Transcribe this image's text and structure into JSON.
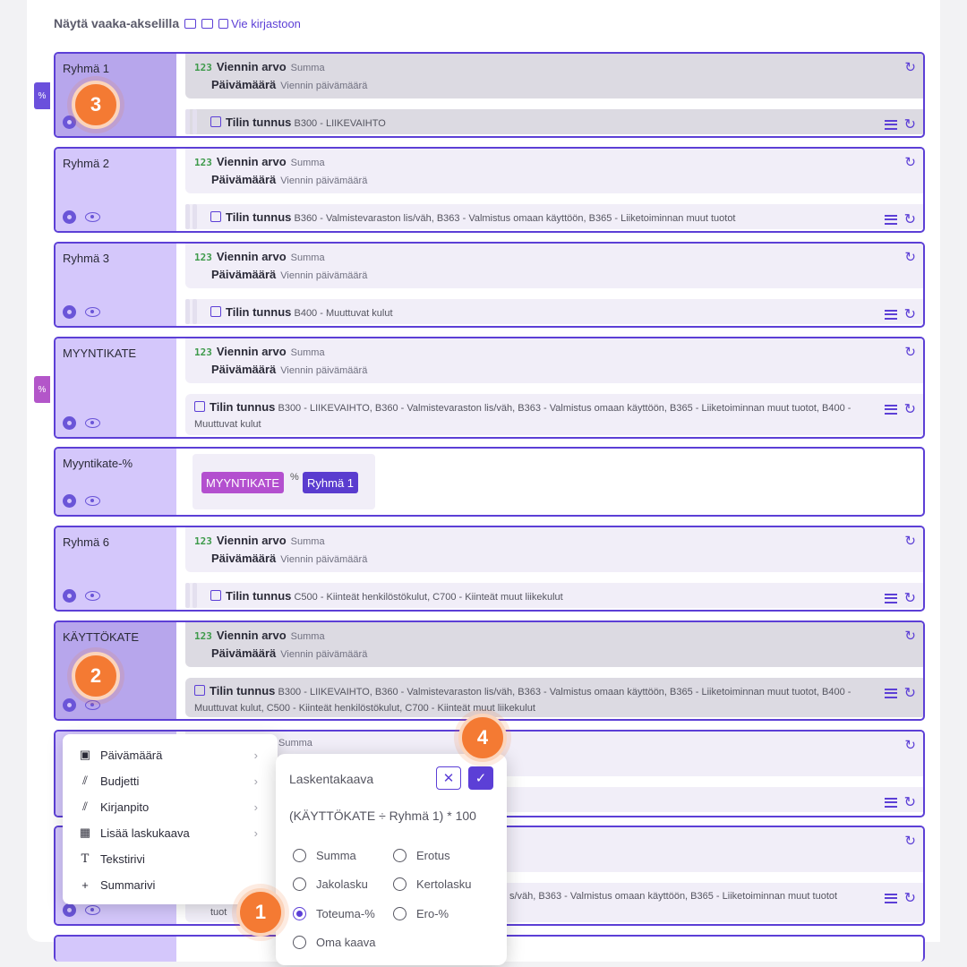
{
  "toolbar": {
    "title": "Näytä vaaka-akselilla",
    "export_label": "Vie kirjastoon"
  },
  "common": {
    "value_field": "Viennin arvo",
    "value_agg": "Summa",
    "date_field": "Päivämäärä",
    "date_sub": "Viennin päivämäärä",
    "account_field": "Tilin tunnus",
    "num_icon": "123",
    "pct": "%",
    "refresh_icon": "↻"
  },
  "groups": [
    {
      "name": "Ryhmä 1",
      "accounts": "B300 - LIIKEVAIHTO"
    },
    {
      "name": "Ryhmä 2",
      "accounts": "B360 - Valmistevaraston lis/väh, B363 - Valmistus omaan käyttöön, B365 - Liiketoiminnan muut tuotot"
    },
    {
      "name": "Ryhmä 3",
      "accounts": "B400 - Muuttuvat kulut"
    },
    {
      "name": "MYYNTIKATE",
      "accounts": "B300 - LIIKEVAIHTO, B360 - Valmistevaraston lis/väh, B363 - Valmistus omaan käyttöön, B365 - Liiketoiminnan muut tuotot, B400 - Muuttuvat kulut"
    },
    {
      "name": "Myyntikate-%",
      "chip_a": "MYYNTIKATE",
      "chip_b": "Ryhmä 1"
    },
    {
      "name": "Ryhmä 6",
      "accounts": "C500 - Kiinteät henkilöstökulut, C700 - Kiinteät muut liikekulut"
    },
    {
      "name": "KÄYTTÖKATE",
      "accounts": "B300 - LIIKEVAIHTO, B360 - Valmistevaraston lis/väh, B363 - Valmistus omaan käyttöön, B365 - Liiketoiminnan muut tuotot, B400 - Muuttuvat kulut, C500 - Kiinteät henkilöstökulut, C700 - Kiinteät muut liikekulut"
    },
    {
      "value_agg": "Summa"
    },
    {
      "accounts_visible": "s/väh, B363 - Valmistus omaan käyttöön, B365 - Liiketoiminnan muut tuotot",
      "accounts_line2_visible": "tuot"
    }
  ],
  "context_menu": [
    {
      "icon": "calendar-icon",
      "label": "Päivämäärä",
      "has_sub": true
    },
    {
      "icon": "chart-icon",
      "label": "Budjetti",
      "has_sub": true
    },
    {
      "icon": "chart-icon",
      "label": "Kirjanpito",
      "has_sub": true
    },
    {
      "icon": "calculator-icon",
      "label": "Lisää laskukaava",
      "has_sub": true
    },
    {
      "icon": "text-icon",
      "label": "Tekstirivi",
      "has_sub": false
    },
    {
      "icon": "plus-icon",
      "label": "Summarivi",
      "has_sub": false
    }
  ],
  "formula_popup": {
    "title": "Laskentakaava",
    "expression": "(KÄYTTÖKATE ÷ Ryhmä 1) * 100",
    "options": [
      "Summa",
      "Erotus",
      "Jakolasku",
      "Kertolasku",
      "Toteuma-%",
      "Ero-%",
      "Oma kaava"
    ],
    "selected": "Toteuma-%"
  },
  "badges": [
    "1",
    "2",
    "3",
    "4"
  ],
  "colors": {
    "accent": "#5c3fd6",
    "badge": "#f47a33",
    "pink_chip": "#b34fcf"
  }
}
